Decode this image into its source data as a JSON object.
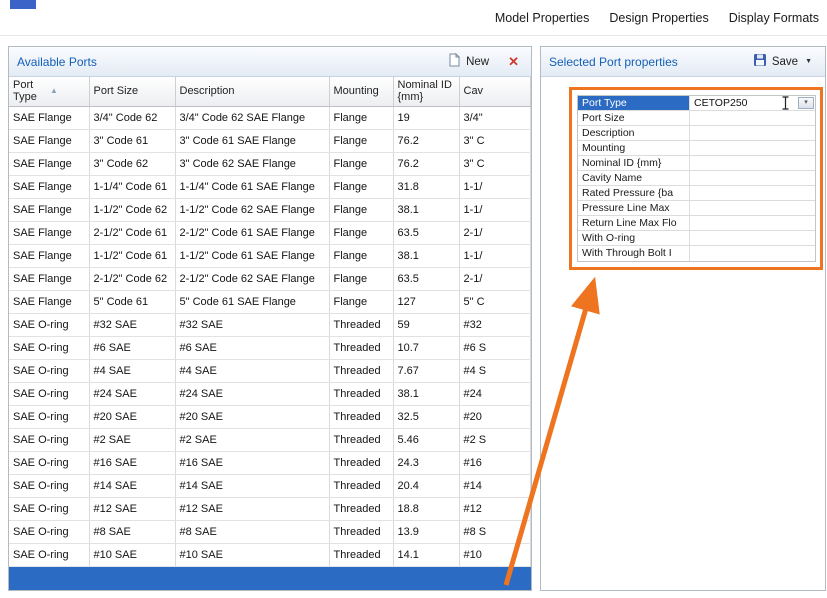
{
  "menubar": {
    "items": [
      "Model Properties",
      "Design Properties",
      "Display Formats"
    ]
  },
  "colors": {
    "selection_blue": "#2b6bc4",
    "title_blue": "#1360b8",
    "annotation_orange": "#ee7420",
    "close_red": "#cf3a30"
  },
  "icons": {
    "sort_glyph": "▲",
    "close_glyph": "✕",
    "save_caret_glyph": "▼",
    "combo_glyph": "▾"
  },
  "left_panel": {
    "title": "Available Ports",
    "toolbar": {
      "new_label": "New"
    },
    "table": {
      "columns": [
        "Port Type",
        "Port Size",
        "Description",
        "Mounting",
        "Nominal ID {mm}",
        "Cav"
      ],
      "rows": [
        [
          "SAE Flange",
          "3/4\" Code 62",
          "3/4\" Code 62 SAE Flange",
          "Flange",
          "19",
          "3/4\""
        ],
        [
          "SAE Flange",
          "3\" Code 61",
          "3\" Code 61 SAE Flange",
          "Flange",
          "76.2",
          "3\" C"
        ],
        [
          "SAE Flange",
          "3\" Code 62",
          "3\" Code 62 SAE Flange",
          "Flange",
          "76.2",
          "3\" C"
        ],
        [
          "SAE Flange",
          "1-1/4\" Code 61",
          "1-1/4\" Code 61 SAE Flange",
          "Flange",
          "31.8",
          "1-1/"
        ],
        [
          "SAE Flange",
          "1-1/2\" Code 62",
          "1-1/2\" Code 62 SAE Flange",
          "Flange",
          "38.1",
          "1-1/"
        ],
        [
          "SAE Flange",
          "2-1/2\" Code 61",
          "2-1/2\" Code 61 SAE Flange",
          "Flange",
          "63.5",
          "2-1/"
        ],
        [
          "SAE Flange",
          "1-1/2\" Code 61",
          "1-1/2\" Code 61 SAE Flange",
          "Flange",
          "38.1",
          "1-1/"
        ],
        [
          "SAE Flange",
          "2-1/2\" Code 62",
          "2-1/2\" Code 62 SAE Flange",
          "Flange",
          "63.5",
          "2-1/"
        ],
        [
          "SAE Flange",
          "5\" Code 61",
          "5\" Code 61 SAE Flange",
          "Flange",
          "127",
          "5\" C"
        ],
        [
          "SAE O-ring",
          "#32 SAE",
          "#32 SAE",
          "Threaded",
          "59",
          "#32"
        ],
        [
          "SAE O-ring",
          "#6 SAE",
          "#6 SAE",
          "Threaded",
          "10.7",
          "#6 S"
        ],
        [
          "SAE O-ring",
          "#4 SAE",
          "#4 SAE",
          "Threaded",
          "7.67",
          "#4 S"
        ],
        [
          "SAE O-ring",
          "#24 SAE",
          "#24 SAE",
          "Threaded",
          "38.1",
          "#24"
        ],
        [
          "SAE O-ring",
          "#20 SAE",
          "#20 SAE",
          "Threaded",
          "32.5",
          "#20"
        ],
        [
          "SAE O-ring",
          "#2 SAE",
          "#2 SAE",
          "Threaded",
          "5.46",
          "#2 S"
        ],
        [
          "SAE O-ring",
          "#16 SAE",
          "#16 SAE",
          "Threaded",
          "24.3",
          "#16"
        ],
        [
          "SAE O-ring",
          "#14 SAE",
          "#14 SAE",
          "Threaded",
          "20.4",
          "#14"
        ],
        [
          "SAE O-ring",
          "#12 SAE",
          "#12 SAE",
          "Threaded",
          "18.8",
          "#12"
        ],
        [
          "SAE O-ring",
          "#8 SAE",
          "#8 SAE",
          "Threaded",
          "13.9",
          "#8 S"
        ],
        [
          "SAE O-ring",
          "#10 SAE",
          "#10 SAE",
          "Threaded",
          "14.1",
          "#10"
        ]
      ],
      "new_row_selected": true
    }
  },
  "right_panel": {
    "title": "Selected Port properties",
    "toolbar": {
      "save_label": "Save"
    },
    "selected_property_index": 0,
    "properties": [
      {
        "label": "Port Type",
        "value": "CETOP250"
      },
      {
        "label": "Port Size",
        "value": ""
      },
      {
        "label": "Description",
        "value": ""
      },
      {
        "label": "Mounting",
        "value": ""
      },
      {
        "label": "Nominal ID {mm}",
        "value": ""
      },
      {
        "label": "Cavity Name",
        "value": ""
      },
      {
        "label": "Rated Pressure {ba",
        "value": ""
      },
      {
        "label": "Pressure Line Max",
        "value": ""
      },
      {
        "label": "Return Line Max Flo",
        "value": ""
      },
      {
        "label": "With O-ring",
        "value": ""
      },
      {
        "label": "With Through Bolt I",
        "value": ""
      }
    ]
  }
}
